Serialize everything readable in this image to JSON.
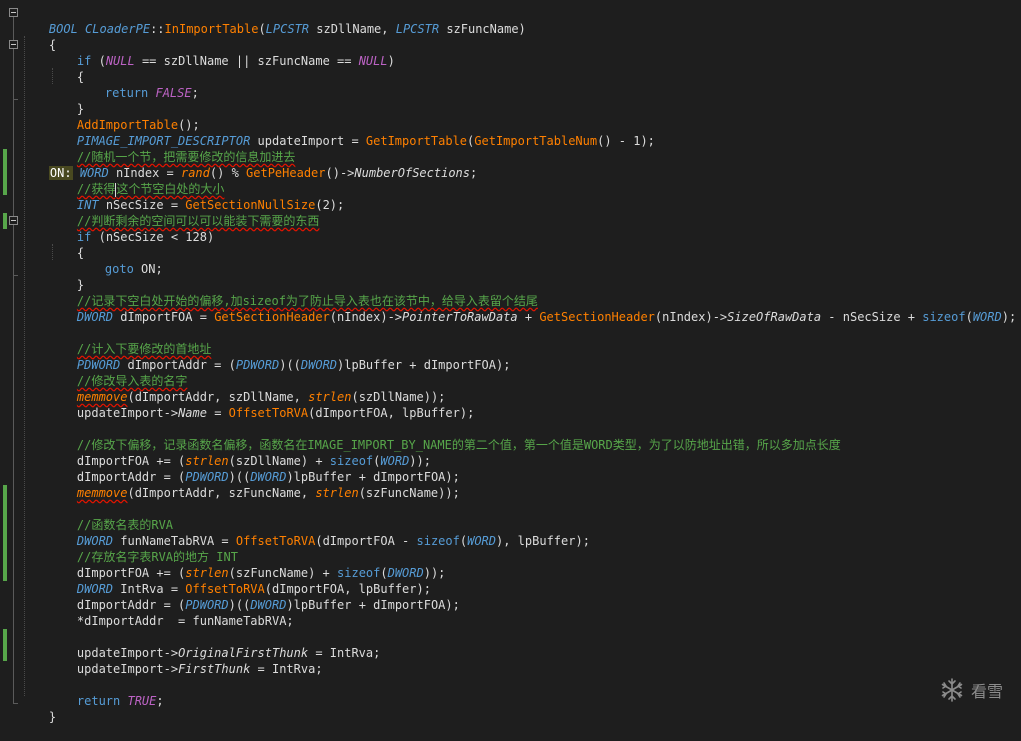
{
  "lines": [
    [
      "BOOL ",
      "CLoaderPE",
      "::",
      "InImportTable",
      "(",
      "LPCSTR ",
      "szDllName, ",
      "LPCSTR ",
      "szFuncName)"
    ],
    [
      "{"
    ],
    [
      "if ",
      "(",
      "NULL",
      " == szDllName || szFuncName == ",
      "NULL",
      ")"
    ],
    [
      "{"
    ],
    [
      "return ",
      "FALSE",
      ";"
    ],
    [
      "}"
    ],
    [
      "AddImportTable",
      "();"
    ],
    [
      "PIMAGE_IMPORT_DESCRIPTOR",
      " updateImport = ",
      "GetImportTable",
      "(",
      "GetImportTableNum",
      "() - 1);"
    ],
    [
      "//随机一个节，把需要修改的信息加进去"
    ],
    [
      "ON:",
      " ",
      "WORD",
      " nIndex = ",
      "rand",
      "() % ",
      "GetPeHeader",
      "()->",
      "NumberOfSections",
      ";"
    ],
    [
      "//获得",
      "这个节空白处的大小"
    ],
    [
      "INT",
      " nSecSize = ",
      "GetSectionNullSize",
      "(2);"
    ],
    [
      "//判断剩余的空间可以可以能装下需要的东西"
    ],
    [
      "if ",
      "(nSecSize < 128)"
    ],
    [
      "{"
    ],
    [
      "goto ",
      "ON;"
    ],
    [
      "}"
    ],
    [
      "//记录下空白处开始的偏移,加sizeof为了防止导入表也在该节中，给导入表留个结尾"
    ],
    [
      "DWORD",
      " dImportFOA = ",
      "GetSectionHeader",
      "(nIndex)->",
      "PointerToRawData",
      " + ",
      "GetSectionHeader",
      "(nIndex)->",
      "SizeOfRawData",
      " - nSecSize + ",
      "sizeof",
      "(",
      "WORD",
      ");"
    ],
    [
      ""
    ],
    [
      "//计入下要修改的首地址"
    ],
    [
      "PDWORD",
      " dImportAddr = (",
      "PDWORD",
      ")((",
      "DWORD",
      ")lpBuffer + dImportFOA);"
    ],
    [
      "//修改导入表的名字"
    ],
    [
      "memmove",
      "(dImportAddr, szDllName, ",
      "strlen",
      "(szDllName));"
    ],
    [
      "updateImport->",
      "Name",
      " = ",
      "OffsetToRVA",
      "(dImportFOA, lpBuffer);"
    ],
    [
      ""
    ],
    [
      "//修改下偏移，记录函数名偏移，函数名在IMAGE_IMPORT_BY_NAME的第二个值，第一个值是WORD类型，为了以防地址出错，所以多加点长度"
    ],
    [
      "dImportFOA += (",
      "strlen",
      "(szDllName) + ",
      "sizeof",
      "(",
      "WORD",
      "));"
    ],
    [
      "dImportAddr = (",
      "PDWORD",
      ")((",
      "DWORD",
      ")lpBuffer + dImportFOA);"
    ],
    [
      "memmove",
      "(dImportAddr, szFuncName, ",
      "strlen",
      "(szFuncName));"
    ],
    [
      ""
    ],
    [
      "//函数名表的RVA"
    ],
    [
      "DWORD",
      " funNameTabRVA = ",
      "OffsetToRVA",
      "(dImportFOA - ",
      "sizeof",
      "(",
      "WORD",
      "), lpBuffer);"
    ],
    [
      "//存放名字表RVA的地方 INT"
    ],
    [
      "dImportFOA += (",
      "strlen",
      "(szFuncName) + ",
      "sizeof",
      "(",
      "DWORD",
      "));"
    ],
    [
      "DWORD",
      " IntRva = ",
      "OffsetToRVA",
      "(dImportFOA, lpBuffer);"
    ],
    [
      "dImportAddr = (",
      "PDWORD",
      ")((",
      "DWORD",
      ")lpBuffer + dImportFOA);"
    ],
    [
      "*dImportAddr  = funNameTabRVA;"
    ],
    [
      ""
    ],
    [
      "updateImport->",
      "OriginalFirstThunk",
      " = IntRva;"
    ],
    [
      "updateImport->",
      "FirstThunk",
      " = IntRva;"
    ],
    [
      ""
    ],
    [
      "return ",
      "TRUE",
      ";"
    ],
    [
      "}"
    ]
  ],
  "watermark_text": "看雪",
  "colors": {
    "background": "#1e1e1e",
    "keyword": "#569cd6",
    "function": "#ff8000",
    "comment": "#57a64a",
    "text": "#dcdcdc",
    "change_bar": "#57a64a"
  },
  "icons": {
    "watermark": "snowflake-icon"
  }
}
